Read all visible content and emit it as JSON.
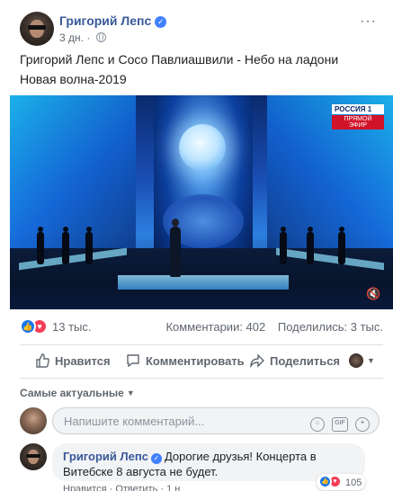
{
  "post": {
    "author": "Григорий Лепс",
    "time": "3 дн.",
    "audience_icon": "globe-icon",
    "more_icon": "···",
    "text_line1": "Григорий Лепс и Сосо Павлиашвили - Небо на ладони",
    "text_line2": "Новая волна-2019"
  },
  "video": {
    "channel_name": "РОССИЯ 1",
    "live_label": "ПРЯМОЙ ЭФИР",
    "mute_icon": "volume-mute-icon"
  },
  "stats": {
    "reactions_count": "13 тыс.",
    "comments": "Комментарии: 402",
    "shares": "Поделились: 3 тыс."
  },
  "actions": {
    "like": "Нравится",
    "comment": "Комментировать",
    "share": "Поделиться"
  },
  "comments_section": {
    "sort_label": "Самые актуальные",
    "input_placeholder": "Напишите комментарий...",
    "input_icons": [
      "emoji-icon",
      "gif-icon",
      "sticker-icon"
    ],
    "gif_label": "GIF"
  },
  "comment": {
    "author": "Григорий Лепс",
    "text": "Дорогие друзья! Концерта в Витебске 8 августа не будет.",
    "reactions_count": "105",
    "actions_text": "Нравится · Ответить · 1 н"
  },
  "colors": {
    "link_blue": "#385898",
    "like_blue": "#1877f2",
    "love_red": "#f33e58",
    "muted_text": "#606770"
  }
}
